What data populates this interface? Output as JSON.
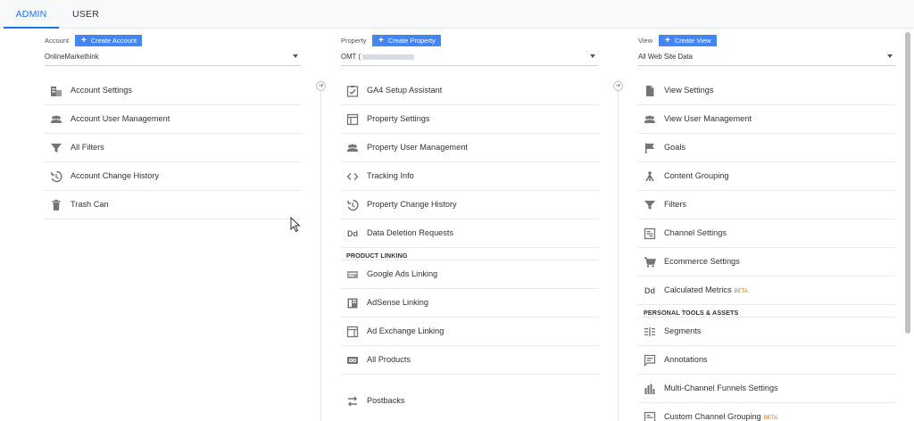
{
  "tabs": {
    "admin": "ADMIN",
    "user": "USER"
  },
  "account": {
    "label": "Account",
    "create": "Create Account",
    "selected": "OnlineMarkethink",
    "items": [
      {
        "icon": "building-icon",
        "label": "Account Settings"
      },
      {
        "icon": "people-icon",
        "label": "Account User Management"
      },
      {
        "icon": "filter-icon",
        "label": "All Filters"
      },
      {
        "icon": "history-icon",
        "label": "Account Change History"
      },
      {
        "icon": "trash-icon",
        "label": "Trash Can"
      }
    ]
  },
  "property": {
    "label": "Property",
    "create": "Create Property",
    "selected": "OMT (",
    "items": [
      {
        "icon": "checklist-icon",
        "label": "GA4 Setup Assistant"
      },
      {
        "icon": "settings-page-icon",
        "label": "Property Settings"
      },
      {
        "icon": "people-icon",
        "label": "Property User Management"
      },
      {
        "icon": "code-icon",
        "label": "Tracking Info"
      },
      {
        "icon": "history-icon",
        "label": "Property Change History"
      },
      {
        "icon": "dd-icon",
        "label": "Data Deletion Requests"
      }
    ],
    "section": "PRODUCT LINKING",
    "linking": [
      {
        "icon": "ads-icon",
        "label": "Google Ads Linking"
      },
      {
        "icon": "adsense-icon",
        "label": "AdSense Linking"
      },
      {
        "icon": "adexchange-icon",
        "label": "Ad Exchange Linking"
      },
      {
        "icon": "products-icon",
        "label": "All Products"
      },
      {
        "icon": "postbacks-icon",
        "label": "Postbacks"
      }
    ]
  },
  "view": {
    "label": "View",
    "create": "Create View",
    "selected": "All Web Site Data",
    "items": [
      {
        "icon": "document-icon",
        "label": "View Settings"
      },
      {
        "icon": "people-icon",
        "label": "View User Management"
      },
      {
        "icon": "flag-icon",
        "label": "Goals"
      },
      {
        "icon": "grouping-icon",
        "label": "Content Grouping"
      },
      {
        "icon": "filter-icon",
        "label": "Filters"
      },
      {
        "icon": "channel-icon",
        "label": "Channel Settings"
      },
      {
        "icon": "cart-icon",
        "label": "Ecommerce Settings"
      },
      {
        "icon": "dd-icon",
        "label": "Calculated Metrics",
        "badge": "BETA"
      }
    ],
    "section": "PERSONAL TOOLS & ASSETS",
    "tools": [
      {
        "icon": "segments-icon",
        "label": "Segments"
      },
      {
        "icon": "annotation-icon",
        "label": "Annotations"
      },
      {
        "icon": "bars-icon",
        "label": "Multi-Channel Funnels Settings"
      },
      {
        "icon": "channel-icon",
        "label": "Custom Channel Grouping",
        "badge": "BETA"
      }
    ]
  }
}
